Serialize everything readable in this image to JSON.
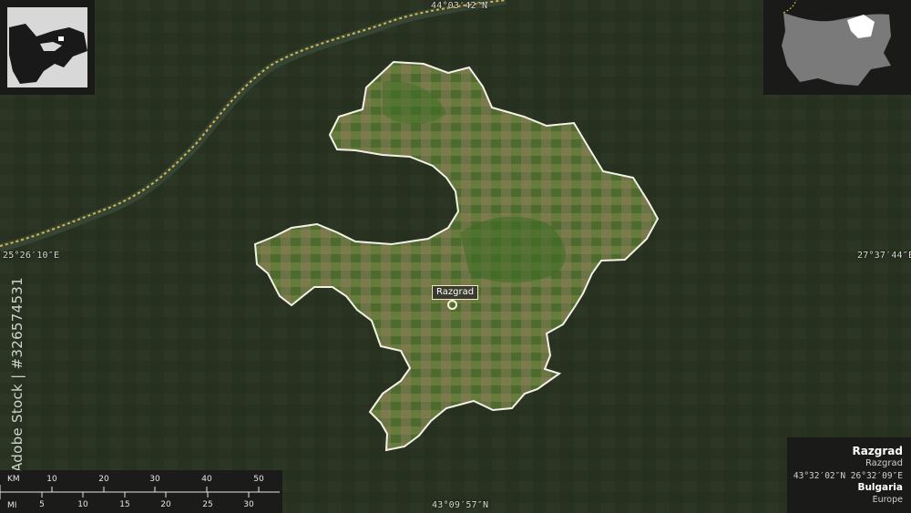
{
  "coordinates": {
    "top": "44°03′42″N",
    "bottom": "43°09′57″N",
    "left": "25°26′10″E",
    "right": "27°37′44″E"
  },
  "city": {
    "name": "Razgrad"
  },
  "scale": {
    "km_unit": "KM",
    "mi_unit": "MI",
    "km_ticks": [
      "10",
      "20",
      "30",
      "40",
      "50"
    ],
    "mi_ticks": [
      "5",
      "10",
      "15",
      "20",
      "25",
      "30"
    ]
  },
  "info": {
    "name": "Razgrad",
    "subname": "Razgrad",
    "latlon": "43°32′02″N 26°32′09″E",
    "country": "Bulgaria",
    "continent": "Europe"
  },
  "watermark": "Adobe Stock | #326574531",
  "colors": {
    "region_fill": "#5d6a3a",
    "region_outline": "#f4f1e6",
    "background": "#26301f",
    "border_line": "#d7b64a",
    "inset_bg": "#191919",
    "inset_land": "#7a7a7a",
    "inset_highlight": "#ffffff"
  },
  "icons": [
    "city-marker-icon",
    "globe-locator-map",
    "country-locator-map"
  ]
}
